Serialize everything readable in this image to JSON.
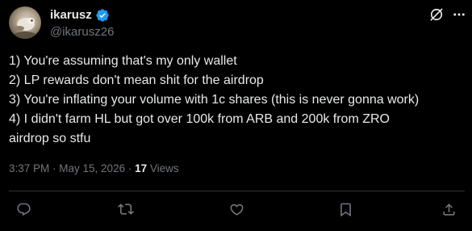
{
  "author": {
    "display_name": "ikarusz",
    "handle": "@ikarusz26",
    "verified": true,
    "verified_color": "#1d9bf0"
  },
  "tweet": {
    "lines": [
      "1) You're assuming that's my only wallet",
      "2) LP rewards don't mean shit for the airdrop",
      "3) You're inflating your volume with 1c shares (this is never gonna work)",
      "4) I didn't farm HL but got over 100k from ARB and 200k from ZRO",
      "airdrop so stfu"
    ]
  },
  "meta": {
    "time": "3:37 PM",
    "separator": " · ",
    "date": "May 15, 2026",
    "separator2": " · ",
    "views_count": "17",
    "views_label": " Views"
  },
  "actions": {
    "reply_icon": "reply-icon",
    "retweet_icon": "retweet-icon",
    "like_icon": "heart-icon",
    "bookmark_icon": "bookmark-icon",
    "share_icon": "share-icon"
  },
  "colors": {
    "background": "#000000",
    "text": "#e7e9ea",
    "secondary": "#71767b",
    "divider": "#2f3336"
  }
}
